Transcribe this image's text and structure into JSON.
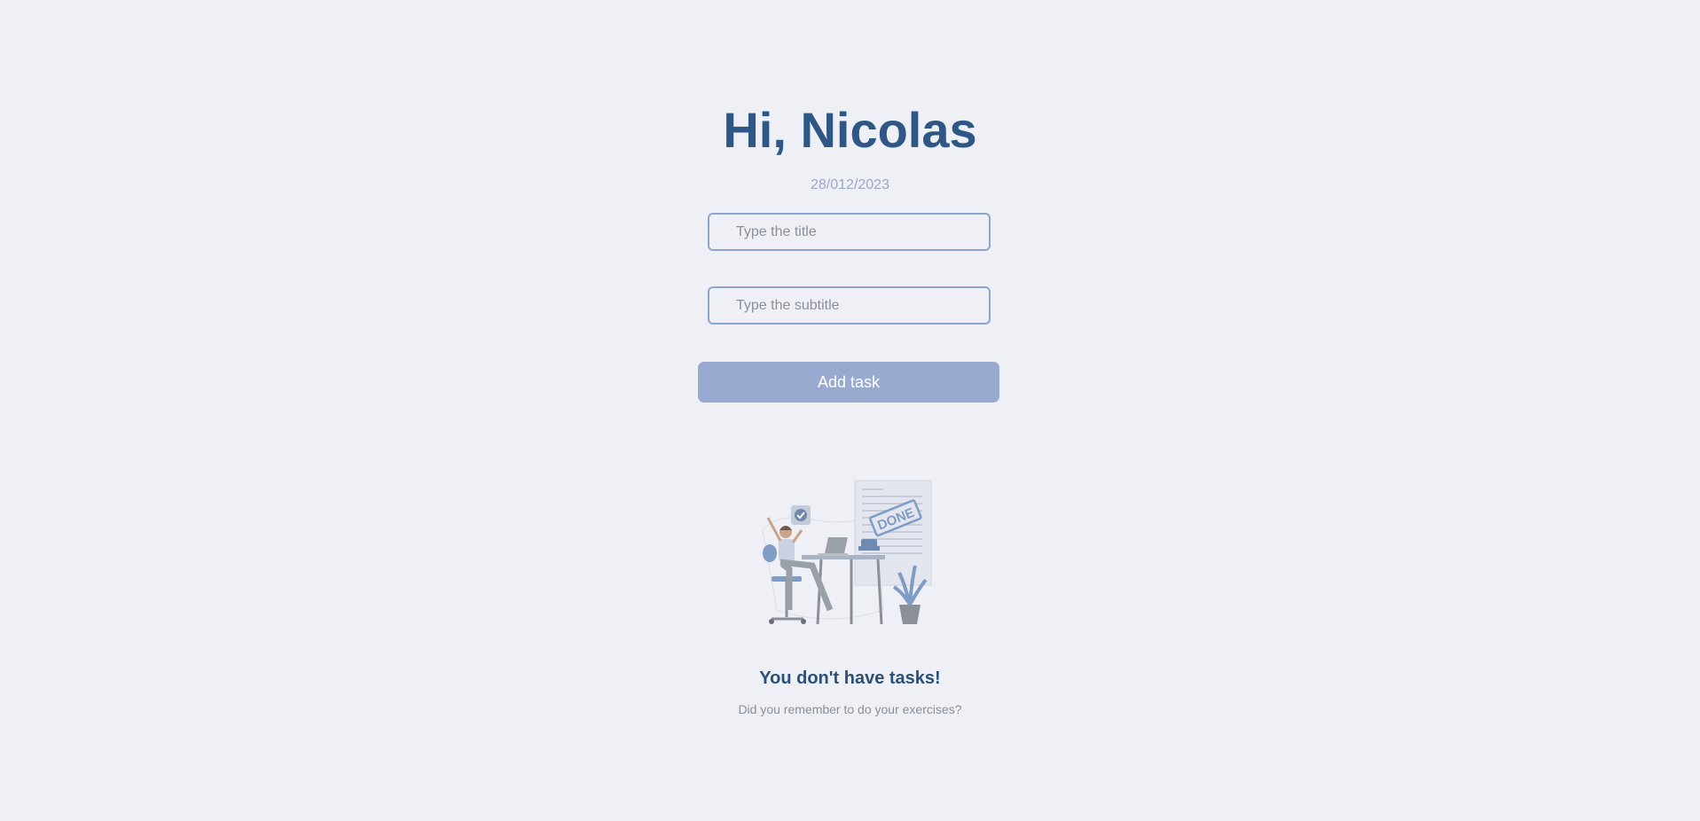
{
  "header": {
    "greeting": "Hi, Nicolas",
    "date": "28/012/2023"
  },
  "form": {
    "title_placeholder": "Type the title",
    "subtitle_placeholder": "Type the subtitle",
    "add_button_label": "Add task"
  },
  "empty_state": {
    "illustration_icon": "task-done-illustration-icon",
    "stamp_text": "DONE",
    "title": "You don't have tasks!",
    "subtitle": "Did you remember to do your exercises?"
  },
  "colors": {
    "background": "#eef0f5",
    "accent": "#2e5785",
    "button": "#98aad0",
    "input_border": "#8ea4d2"
  }
}
